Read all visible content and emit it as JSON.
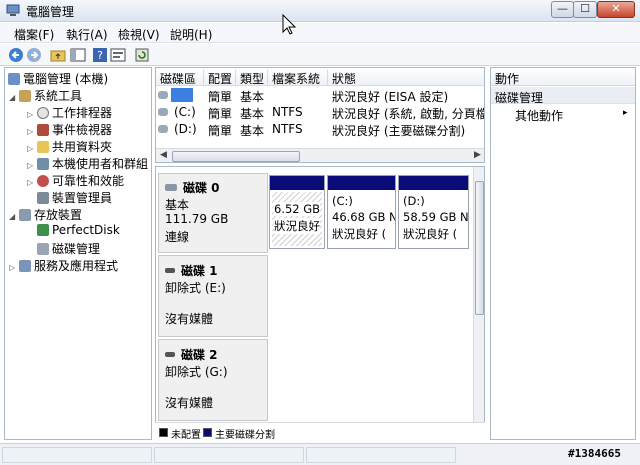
{
  "window": {
    "title": "電腦管理",
    "minimize_label": "—",
    "maximize_label": "☐",
    "close_label": "✕"
  },
  "menu": [
    {
      "label": "檔案(F)"
    },
    {
      "label": "執行(A)"
    },
    {
      "label": "檢視(V)"
    },
    {
      "label": "說明(H)"
    }
  ],
  "toolbar": {
    "icons": [
      "back-arrow-icon",
      "forward-arrow-icon",
      "up-folder-icon",
      "show-hide-tree-icon",
      "help-icon",
      "properties-icon",
      "refresh-icon"
    ]
  },
  "tree": {
    "root": "電腦管理 (本機)",
    "system_tools": "系統工具",
    "task_scheduler": "工作排程器",
    "event_viewer": "事件檢視器",
    "shared_folders": "共用資料夾",
    "local_users": "本機使用者和群組",
    "reliability": "可靠性和效能",
    "device_manager": "裝置管理員",
    "storage": "存放裝置",
    "perfectdisk": "PerfectDisk",
    "disk_management": "磁碟管理",
    "services": "服務及應用程式"
  },
  "volume_list": {
    "headers": [
      "磁碟區",
      "配置",
      "類型",
      "檔案系統",
      "狀態"
    ],
    "rows": [
      {
        "volume": "",
        "layout": "簡單",
        "type": "基本",
        "fs": "",
        "status": "狀況良好 (EISA 設定)"
      },
      {
        "volume": "(C:)",
        "layout": "簡單",
        "type": "基本",
        "fs": "NTFS",
        "status": "狀況良好 (系統, 啟動, 分頁檔"
      },
      {
        "volume": "(D:)",
        "layout": "簡單",
        "type": "基本",
        "fs": "NTFS",
        "status": "狀況良好 (主要磁碟分割)"
      }
    ]
  },
  "disks": [
    {
      "name": "磁碟 0",
      "type": "基本",
      "size": "111.79 GB",
      "state": "連線",
      "partitions": [
        {
          "letter": "",
          "size": "6.52 GB",
          "status": "狀況良好"
        },
        {
          "letter": "(C:)",
          "size": "46.68 GB N",
          "status": "狀況良好 (　"
        },
        {
          "letter": "(D:)",
          "size": "58.59 GB N",
          "status": "狀況良好 (　"
        }
      ]
    },
    {
      "name": "磁碟 1",
      "type": "卸除式 (E:)",
      "media": "沒有媒體"
    },
    {
      "name": "磁碟 2",
      "type": "卸除式 (G:)",
      "media": "沒有媒體"
    }
  ],
  "legend": [
    {
      "label": "未配置",
      "color": "#000000"
    },
    {
      "label": "主要磁碟分割",
      "color": "#0a0a78"
    }
  ],
  "actions": {
    "header": "動作",
    "section": "磁碟管理",
    "item": "其他動作",
    "chevron": "▸"
  },
  "watermark": "#1384665"
}
